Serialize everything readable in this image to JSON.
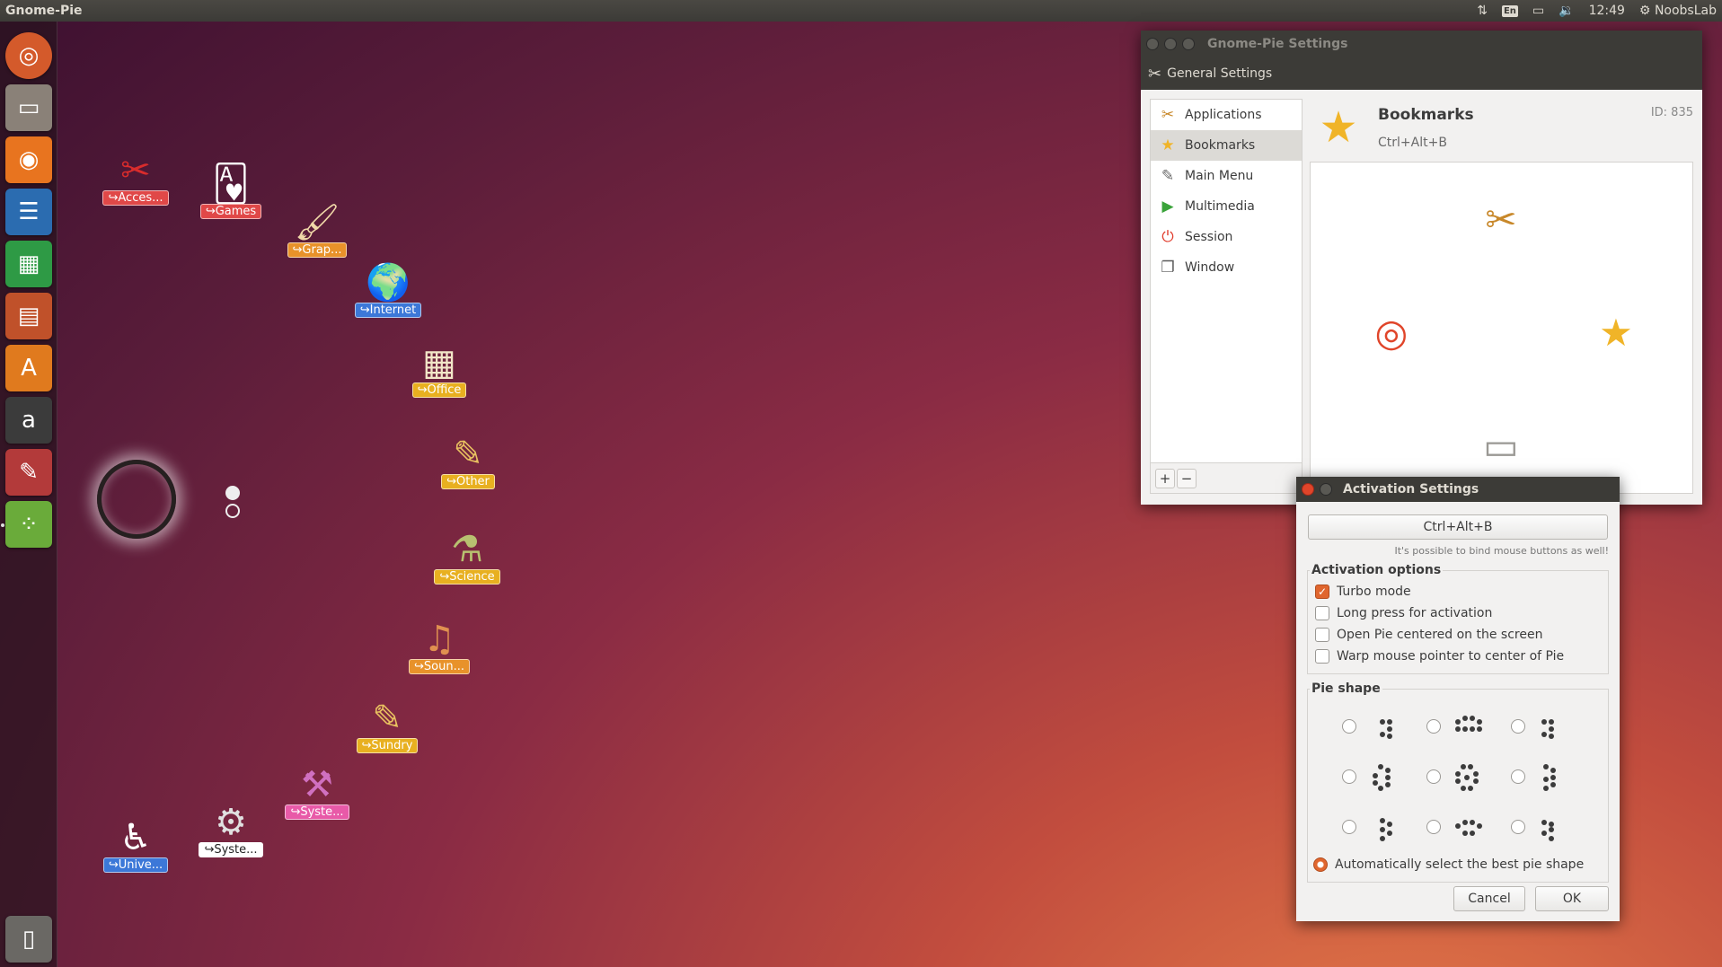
{
  "topbar": {
    "app_name": "Gnome-Pie",
    "keyboard": "En",
    "time": "12:49",
    "user": "NoobsLab"
  },
  "launcher": {
    "items": [
      {
        "name": "dash",
        "glyph": "◎",
        "color": "#d45a2b"
      },
      {
        "name": "files",
        "glyph": "▭",
        "color": "#8a8178"
      },
      {
        "name": "firefox",
        "glyph": "◉",
        "color": "#e8741f"
      },
      {
        "name": "writer",
        "glyph": "☰",
        "color": "#2b6cb0"
      },
      {
        "name": "calc",
        "glyph": "▦",
        "color": "#2e9a45"
      },
      {
        "name": "impress",
        "glyph": "▤",
        "color": "#c0512a"
      },
      {
        "name": "software-center",
        "glyph": "A",
        "color": "#e07a1e"
      },
      {
        "name": "amazon",
        "glyph": "a",
        "color": "#3b3b3b"
      },
      {
        "name": "system-settings",
        "glyph": "✎",
        "color": "#b33a3a"
      },
      {
        "name": "gnome-pie",
        "glyph": "⁘",
        "color": "#6aab3a"
      }
    ],
    "trash_glyph": "▯"
  },
  "desktop": {
    "pie_items": [
      {
        "label": "↪Acces...",
        "glyph": "✂",
        "color": "#e04848",
        "glyph_color": "#d92c2c"
      },
      {
        "label": "↪Games",
        "glyph": "🂱",
        "color": "#e04848",
        "glyph_color": "#ffffff"
      },
      {
        "label": "↪Grap...",
        "glyph": "🖌",
        "color": "#e8922a",
        "glyph_color": "#f0d8a8"
      },
      {
        "label": "↪Internet",
        "glyph": "🌍",
        "color": "#3c78d8",
        "glyph_color": "#6fa8e8"
      },
      {
        "label": "↪Office",
        "glyph": "▦",
        "color": "#e8b020",
        "glyph_color": "#f2e6c8"
      },
      {
        "label": "↪Other",
        "glyph": "✎",
        "color": "#e8b020",
        "glyph_color": "#e8c060"
      },
      {
        "label": "↪Science",
        "glyph": "⚗",
        "color": "#e8b020",
        "glyph_color": "#b8c070"
      },
      {
        "label": "↪Soun...",
        "glyph": "♫",
        "color": "#e8922a",
        "glyph_color": "#e09050"
      },
      {
        "label": "↪Sundry",
        "glyph": "✎",
        "color": "#e8b020",
        "glyph_color": "#e8c060"
      },
      {
        "label": "↪Syste...",
        "glyph": "⚒",
        "color": "#e85aa8",
        "glyph_color": "#d070c0"
      },
      {
        "label": "↪Syste...",
        "glyph": "⚙",
        "color": "#ffffff",
        "glyph_color": "#e0e0e0"
      },
      {
        "label": "↪Unive...",
        "glyph": "♿",
        "color": "#3c78d8",
        "glyph_color": "#ffffff"
      }
    ]
  },
  "gnome_pie_window": {
    "title": "Gnome-Pie Settings",
    "toolbar_label": "General Settings",
    "pies": [
      {
        "label": "Applications",
        "glyph": "✂",
        "color": "#c8882a"
      },
      {
        "label": "Bookmarks",
        "glyph": "★",
        "color": "#f0b428"
      },
      {
        "label": "Main Menu",
        "glyph": "✎",
        "color": "#6a6a6a"
      },
      {
        "label": "Multimedia",
        "glyph": "▶",
        "color": "#3aa33a"
      },
      {
        "label": "Session",
        "glyph": "⏻",
        "color": "#e03a2a"
      },
      {
        "label": "Window",
        "glyph": "❐",
        "color": "#5a5a5a"
      }
    ],
    "selected_index": 1,
    "add_glyph": "+",
    "remove_glyph": "−",
    "detail": {
      "name": "Bookmarks",
      "hotkey": "Ctrl+Alt+B",
      "id": "ID: 835",
      "slices": [
        {
          "name": "home-folder",
          "glyph": "✂",
          "color": "#c8882a"
        },
        {
          "name": "ubuntu-logo",
          "glyph": "◎",
          "color": "#e0452a"
        },
        {
          "name": "star",
          "glyph": "★",
          "color": "#f0b428"
        },
        {
          "name": "drive",
          "glyph": "▭",
          "color": "#9a9894"
        }
      ]
    }
  },
  "activation_dialog": {
    "title": "Activation Settings",
    "hotkey_button": "Ctrl+Alt+B",
    "hint": "It's possible to bind mouse buttons as well!",
    "options_legend": "Activation options",
    "options": [
      {
        "label": "Turbo mode",
        "checked": true
      },
      {
        "label": "Long press for activation",
        "checked": false
      },
      {
        "label": "Open Pie centered on the screen",
        "checked": false
      },
      {
        "label": "Warp mouse pointer to center of Pie",
        "checked": false
      }
    ],
    "shape_legend": "Pie shape",
    "auto_shape_label": "Automatically select the best pie shape",
    "auto_shape_selected": true,
    "cancel": "Cancel",
    "ok": "OK"
  }
}
